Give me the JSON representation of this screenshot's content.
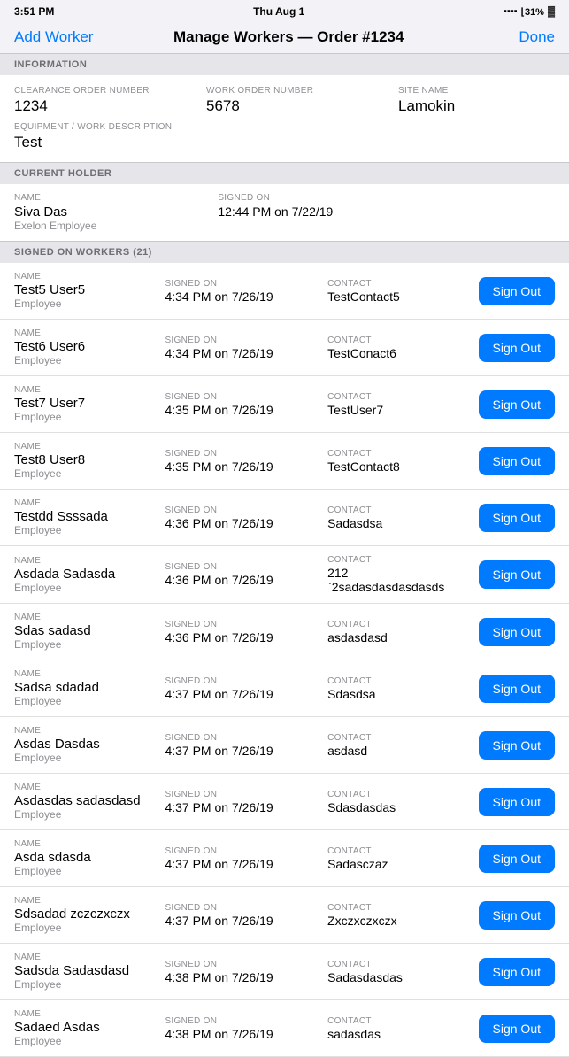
{
  "statusBar": {
    "time": "3:51 PM",
    "day": "Thu Aug 1",
    "signal": "....",
    "wifi": "31%",
    "battery": "🔋"
  },
  "nav": {
    "addWorker": "Add Worker",
    "title": "Manage Workers — Order #1234",
    "done": "Done"
  },
  "sections": {
    "information": "Information",
    "currentHolder": "Current Holder",
    "signedOnWorkers": "Signed On Workers (21)"
  },
  "info": {
    "clearanceLabel": "Clearance Order Number",
    "clearanceValue": "1234",
    "workOrderLabel": "Work Order Number",
    "workOrderValue": "5678",
    "siteLabel": "Site Name",
    "siteValue": "Lamokin",
    "equipmentLabel": "Equipment / Work Description",
    "equipmentValue": "Test"
  },
  "currentHolder": {
    "nameLabel": "Name",
    "nameValue": "Siva Das",
    "roleValue": "Exelon Employee",
    "signedLabel": "Signed On",
    "signedValue": "12:44 PM on 7/22/19"
  },
  "workers": [
    {
      "name": "Test5 User5",
      "role": "Employee",
      "signedOn": "4:34 PM on 7/26/19",
      "contact": "TestContact5"
    },
    {
      "name": "Test6 User6",
      "role": "Employee",
      "signedOn": "4:34 PM on 7/26/19",
      "contact": "TestConact6"
    },
    {
      "name": "Test7 User7",
      "role": "Employee",
      "signedOn": "4:35 PM on 7/26/19",
      "contact": "TestUser7"
    },
    {
      "name": "Test8 User8",
      "role": "Employee",
      "signedOn": "4:35 PM on 7/26/19",
      "contact": "TestContact8"
    },
    {
      "name": "Testdd Ssssada",
      "role": "Employee",
      "signedOn": "4:36 PM on 7/26/19",
      "contact": "Sadasdsa"
    },
    {
      "name": "Asdada Sadasda",
      "role": "Employee",
      "signedOn": "4:36 PM on 7/26/19",
      "contact": "212 `2sadasdasdasdasds"
    },
    {
      "name": "Sdas sadasd",
      "role": "Employee",
      "signedOn": "4:36 PM on 7/26/19",
      "contact": "asdasdasd"
    },
    {
      "name": "Sadsa sdadad",
      "role": "Employee",
      "signedOn": "4:37 PM on 7/26/19",
      "contact": "Sdasdsa"
    },
    {
      "name": "Asdas Dasdas",
      "role": "Employee",
      "signedOn": "4:37 PM on 7/26/19",
      "contact": "asdasd"
    },
    {
      "name": "Asdasdas sadasdasd",
      "role": "Employee",
      "signedOn": "4:37 PM on 7/26/19",
      "contact": "Sdasdasdas"
    },
    {
      "name": "Asda sdasda",
      "role": "Employee",
      "signedOn": "4:37 PM on 7/26/19",
      "contact": "Sadasczaz"
    },
    {
      "name": "Sdsadad zczczxczx",
      "role": "Employee",
      "signedOn": "4:37 PM on 7/26/19",
      "contact": "Zxczxczxczx"
    },
    {
      "name": "Sadsda Sadasdasd",
      "role": "Employee",
      "signedOn": "4:38 PM on 7/26/19",
      "contact": "Sadasdasdas"
    },
    {
      "name": "Sadaed Asdas",
      "role": "Employee",
      "signedOn": "4:38 PM on 7/26/19",
      "contact": "sadasdas"
    }
  ],
  "labels": {
    "name": "Name",
    "signedOn": "Signed On",
    "contact": "Contact",
    "signOut": "Sign Out"
  }
}
